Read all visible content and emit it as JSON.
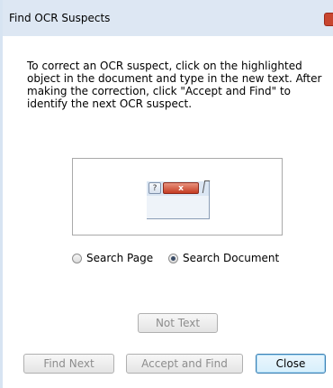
{
  "window": {
    "title": "Find OCR Suspects"
  },
  "instructions": "To correct an OCR suspect, click on the highlighted object in the document and type in the new text. After making the correction, click \"Accept and Find\" to identify the next OCR suspect.",
  "preview": {
    "help_glyph": "?",
    "close_glyph": "x"
  },
  "search_scope": {
    "options": [
      {
        "label": "Search Page",
        "checked": false
      },
      {
        "label": "Search Document",
        "checked": true
      }
    ]
  },
  "buttons": {
    "not_text": "Not Text",
    "find_next": "Find Next",
    "accept_and_find": "Accept and Find",
    "close": "Close"
  },
  "colors": {
    "titlebar": "#dde7f3",
    "title_close": "#c8462f",
    "default_button_border": "#3c7fb1",
    "disabled_text": "#8d8d8d"
  }
}
